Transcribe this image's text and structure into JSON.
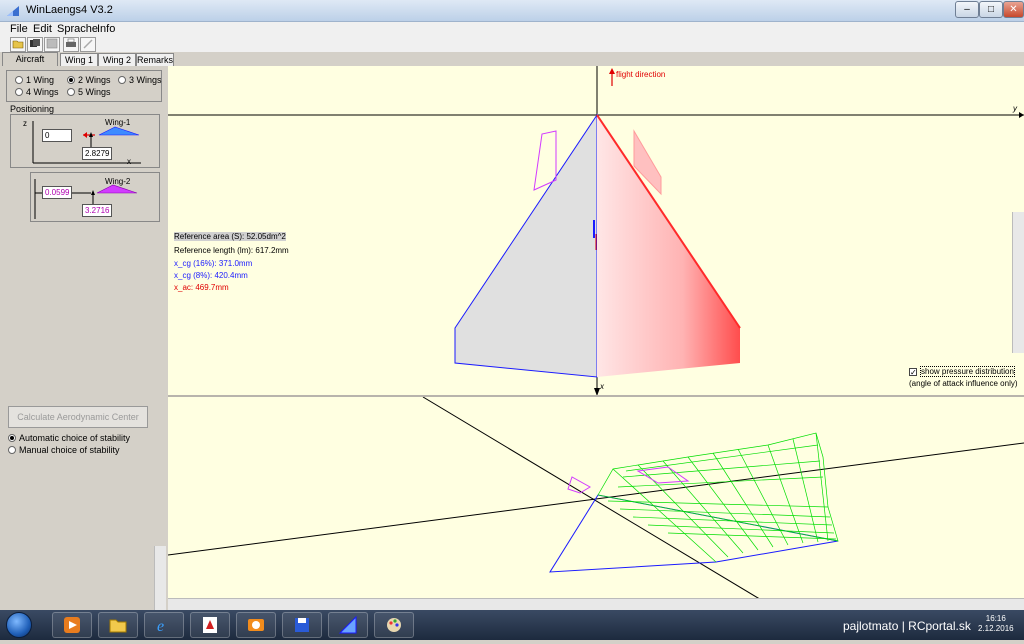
{
  "window": {
    "title": "WinLaengs4  V3.2",
    "controls": {
      "minimize": "–",
      "maximize": "□",
      "close": "✕"
    }
  },
  "menu": [
    "File",
    "Edit",
    "Sprache",
    "Info"
  ],
  "toolbar_icons": [
    "open-folder-icon",
    "save-multi-icon",
    "save-icon",
    "print-icon",
    "pen-icon"
  ],
  "tabs": [
    "Aircraft",
    "Wing 1",
    "Wing 2",
    "Remarks"
  ],
  "wing_count": {
    "options": [
      "1 Wing",
      "2 Wings",
      "3 Wings",
      "4 Wings",
      "5 Wings"
    ],
    "selected": "2 Wings"
  },
  "positioning": {
    "label": "Positioning",
    "axis_z": "z",
    "axis_x": "x",
    "wing1": {
      "label": "Wing-1",
      "z_value": "0",
      "x_value": "2.8279"
    },
    "wing2": {
      "label": "Wing-2",
      "z_value": "0.0599",
      "x_value": "3.2716"
    }
  },
  "calc_button": "Calculate Aerodynamic Center",
  "stability": {
    "options": [
      "Automatic choice of stability",
      "Manual choice of stability"
    ],
    "selected": "Automatic choice of stability"
  },
  "top_view": {
    "flight_direction": "flight direction",
    "axis_y": "y",
    "axis_x": "x",
    "ref_area": "Reference area (S): 52.05dm^2",
    "ref_length": "Reference length (lm): 617.2mm",
    "x_cg_16": "x_cg (16%): 371.0mm",
    "x_cg_8": "x_cg (8%): 420.4mm",
    "x_ac": "x_ac: 469.7mm",
    "show_pressure": "show pressure distribution",
    "show_pressure_checked": true,
    "pressure_note": "(angle of attack influence only)"
  },
  "colors": {
    "view_bg": "#ffffe1",
    "outline_blue": "#1a1aff",
    "wing_grey": "#e0e0e0",
    "pressure_red": "#ff6b6b",
    "mesh_green": "#00dd00",
    "cg_blue": "#1a1aff",
    "ac_red": "#e00000"
  },
  "taskbar": {
    "items": [
      "media-player-icon",
      "folder-icon",
      "ie-icon",
      "acrobat-icon",
      "photo-icon",
      "floppy-icon",
      "winlaengs-icon",
      "paint-icon"
    ],
    "tray_text": "pajlotmato | RCportal.sk",
    "time": "16:16",
    "date": "2.12.2016"
  }
}
